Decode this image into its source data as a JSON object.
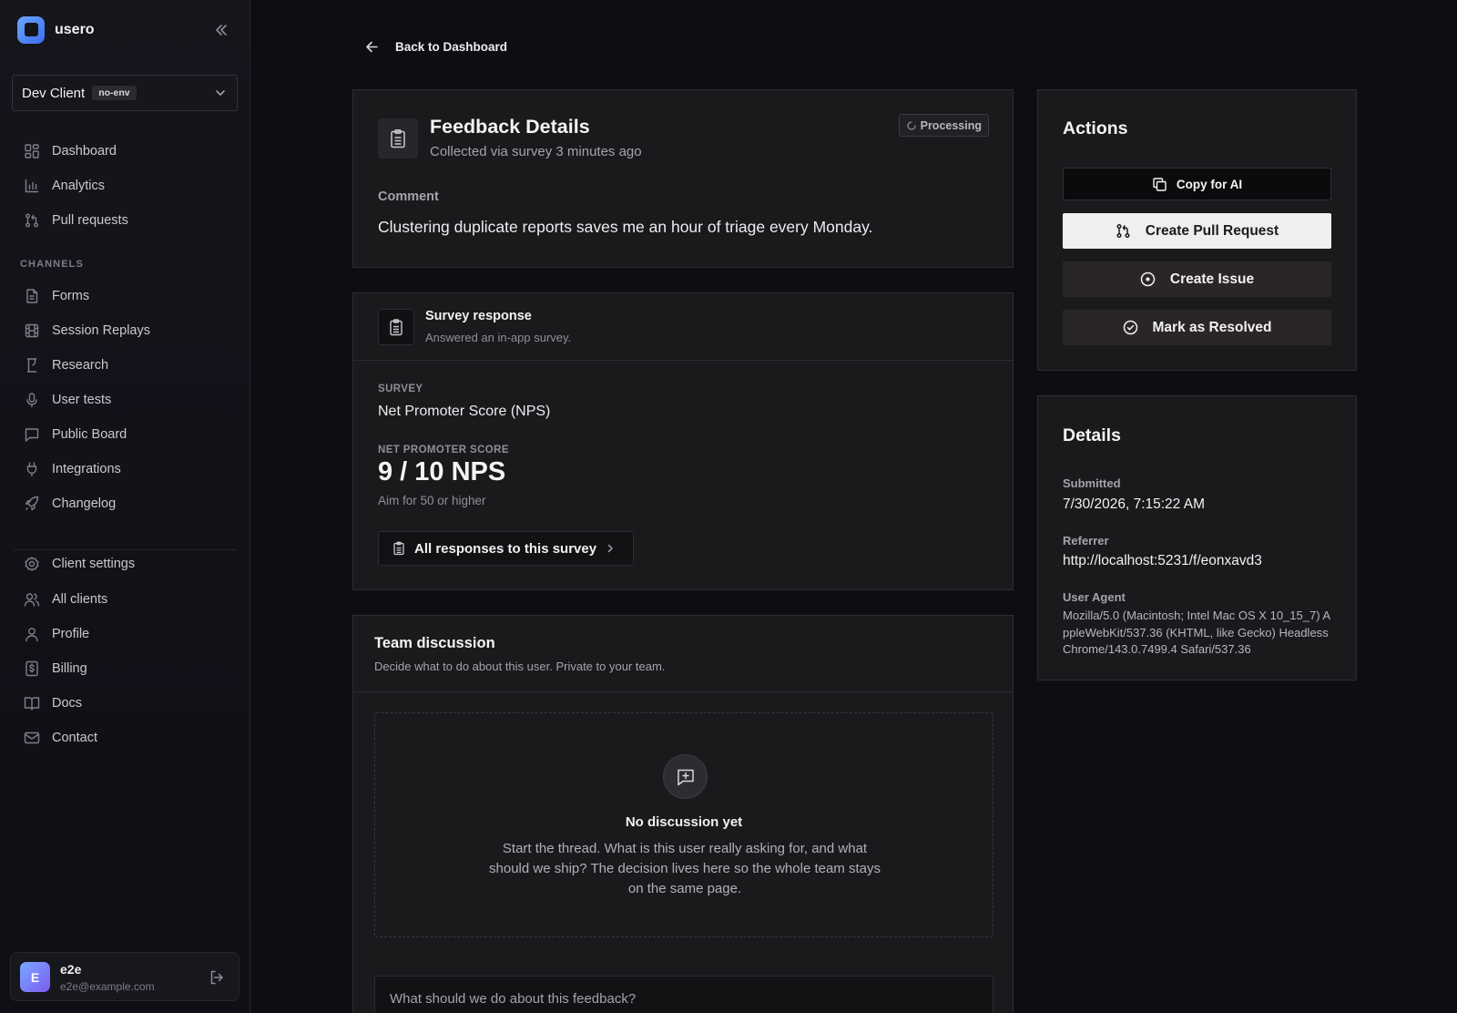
{
  "brand": {
    "name": "usero",
    "logo_color": "#4f86f7"
  },
  "client_select": {
    "name": "Dev Client",
    "env": "no-env"
  },
  "nav": {
    "main": [
      {
        "label": "Dashboard",
        "icon": "dashboard-icon"
      },
      {
        "label": "Analytics",
        "icon": "bar-chart-icon"
      },
      {
        "label": "Pull requests",
        "icon": "git-pull-request-icon"
      }
    ],
    "channels_heading": "CHANNELS",
    "channels": [
      {
        "label": "Forms",
        "icon": "file-text-icon"
      },
      {
        "label": "Session Replays",
        "icon": "film-icon"
      },
      {
        "label": "Research",
        "icon": "hourglass-icon"
      },
      {
        "label": "User tests",
        "icon": "mic-icon"
      },
      {
        "label": "Public Board",
        "icon": "message-square-icon"
      },
      {
        "label": "Integrations",
        "icon": "plug-icon"
      },
      {
        "label": "Changelog",
        "icon": "rocket-icon"
      }
    ],
    "account": [
      {
        "label": "Client settings",
        "icon": "gear-icon"
      },
      {
        "label": "All clients",
        "icon": "users-icon"
      },
      {
        "label": "Profile",
        "icon": "user-icon"
      },
      {
        "label": "Billing",
        "icon": "dollar-icon"
      },
      {
        "label": "Docs",
        "icon": "book-icon"
      },
      {
        "label": "Contact",
        "icon": "mail-icon"
      }
    ]
  },
  "user": {
    "initial": "E",
    "name": "e2e",
    "email": "e2e@example.com"
  },
  "back_link": "Back to Dashboard",
  "feedback": {
    "title": "Feedback Details",
    "subtitle": "Collected via survey 3 minutes ago",
    "status": "Processing",
    "comment_label": "Comment",
    "comment": "Clustering duplicate reports saves me an hour of triage every Monday."
  },
  "survey": {
    "title": "Survey response",
    "subtitle": "Answered an in-app survey.",
    "survey_label": "SURVEY",
    "survey_name": "Net Promoter Score (NPS)",
    "score_label": "NET PROMOTER SCORE",
    "score_value": "9 / 10 NPS",
    "score_hint": "Aim for 50 or higher",
    "all_responses": "All responses to this survey"
  },
  "discussion": {
    "title": "Team discussion",
    "subtitle": "Decide what to do about this user. Private to your team.",
    "empty_title": "No discussion yet",
    "empty_text": "Start the thread. What is this user really asking for, and what should we ship? The decision lives here so the whole team stays on the same page.",
    "input_placeholder": "What should we do about this feedback?"
  },
  "actions": {
    "title": "Actions",
    "copy_ai": "Copy for AI",
    "create_pr": "Create Pull Request",
    "create_issue": "Create Issue",
    "mark_resolved": "Mark as Resolved"
  },
  "details": {
    "title": "Details",
    "submitted_label": "Submitted",
    "submitted_value": "7/30/2026, 7:15:22 AM",
    "referrer_label": "Referrer",
    "referrer_value": "http://localhost:5231/f/eonxavd3",
    "ua_label": "User Agent",
    "ua_value": "Mozilla/5.0 (Macintosh; Intel Mac OS X 10_15_7) AppleWebKit/537.36 (KHTML, like Gecko) HeadlessChrome/143.0.7499.4 Safari/537.36"
  }
}
